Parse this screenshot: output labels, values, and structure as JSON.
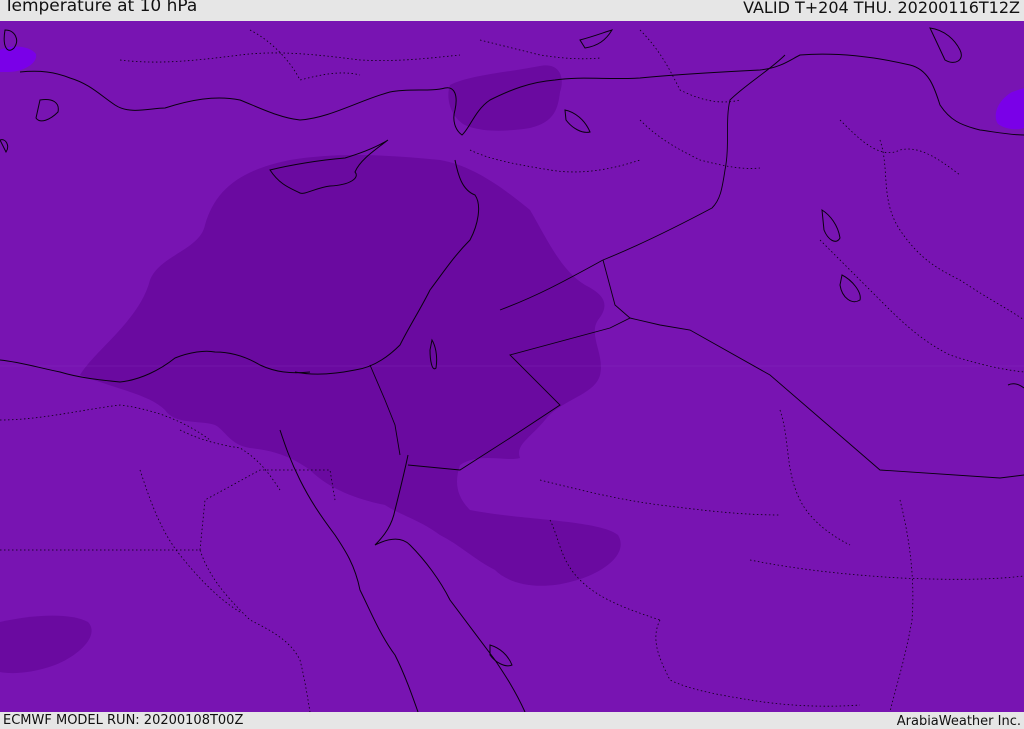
{
  "header": {
    "title": "Temperature at 10 hPa",
    "valid": "VALID T+204 THU. 20200116T12Z"
  },
  "footer": {
    "model_run": "ECMWF MODEL RUN: 20200108T00Z",
    "credit": "ArabiaWeather Inc."
  },
  "colors": {
    "base_field": "#7814b2",
    "cold_field": "#6a0aa0",
    "warm_patch": "#7a00e8",
    "coastline": "#0a0010",
    "bar_background": "#e6e6e6"
  }
}
